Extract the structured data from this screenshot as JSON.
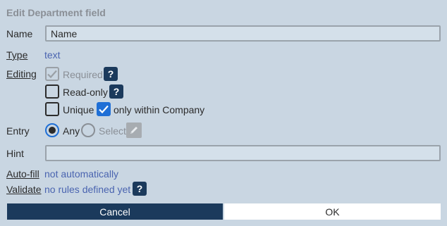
{
  "dialog": {
    "title": "Edit Department field"
  },
  "name": {
    "label": "Name",
    "value": "Name"
  },
  "type": {
    "label": "Type",
    "value": "text"
  },
  "editing": {
    "label": "Editing",
    "required_label": "Required",
    "required_checked": true,
    "readonly_label": "Read-only",
    "readonly_checked": false,
    "unique_label": "Unique",
    "unique_checked": false,
    "within_company_label": "only within Company",
    "within_company_checked": true,
    "help_glyph": "?"
  },
  "entry": {
    "label": "Entry",
    "option_any": "Any",
    "option_select": "Select",
    "selected": "Any"
  },
  "hint": {
    "label": "Hint",
    "value": ""
  },
  "autofill": {
    "label": "Auto-fill",
    "value": "not automatically"
  },
  "validate": {
    "label": "Validate",
    "value": "no rules defined yet"
  },
  "buttons": {
    "cancel": "Cancel",
    "ok": "OK"
  },
  "colors": {
    "background": "#c9d6e2",
    "primary_button": "#1b3a5c",
    "accent": "#1f6fd6",
    "link_value": "#4a64b0"
  },
  "icons": {
    "check": "check-icon",
    "help": "help-icon",
    "pencil": "pencil-icon",
    "radio": "radio-icon"
  }
}
